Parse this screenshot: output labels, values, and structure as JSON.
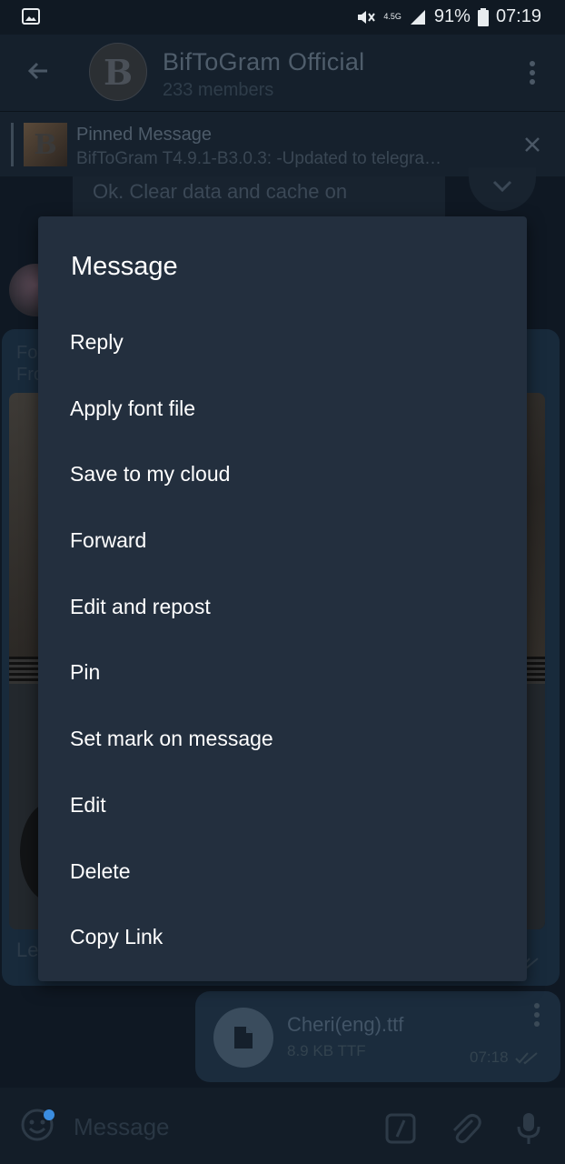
{
  "status_bar": {
    "network": "4.5G",
    "battery": "91%",
    "time": "07:19"
  },
  "header": {
    "title": "BifToGram Official",
    "subtitle": "233 members",
    "avatar_letter": "B"
  },
  "pinned": {
    "title": "Pinned Message",
    "text": "BifToGram T4.9.1-B3.0.3:  -Updated to telegra…"
  },
  "chat": {
    "top_message": "Ok. Clear data and cache on",
    "forwarded_label_line1": "Fo",
    "forwarded_label_line2": "Fro",
    "forwarded_caption": "Le",
    "file": {
      "name": "Cheri(eng).ttf",
      "meta": "8.9 KB TTF",
      "time": "07:18"
    }
  },
  "input": {
    "placeholder": "Message"
  },
  "dialog": {
    "title": "Message",
    "items": [
      {
        "label": "Reply"
      },
      {
        "label": "Apply font file"
      },
      {
        "label": "Save to my cloud"
      },
      {
        "label": "Forward"
      },
      {
        "label": "Edit and repost"
      },
      {
        "label": "Pin"
      },
      {
        "label": "Set mark on message"
      },
      {
        "label": "Edit"
      },
      {
        "label": "Delete"
      },
      {
        "label": "Copy Link"
      }
    ]
  },
  "icons": [
    "gallery-icon",
    "mute-icon",
    "signal-icon",
    "battery-icon",
    "back-arrow-icon",
    "more-vert-icon",
    "close-icon",
    "chevron-down-icon",
    "file-icon",
    "emoji-icon",
    "slash-command-icon",
    "paperclip-icon",
    "microphone-icon"
  ]
}
